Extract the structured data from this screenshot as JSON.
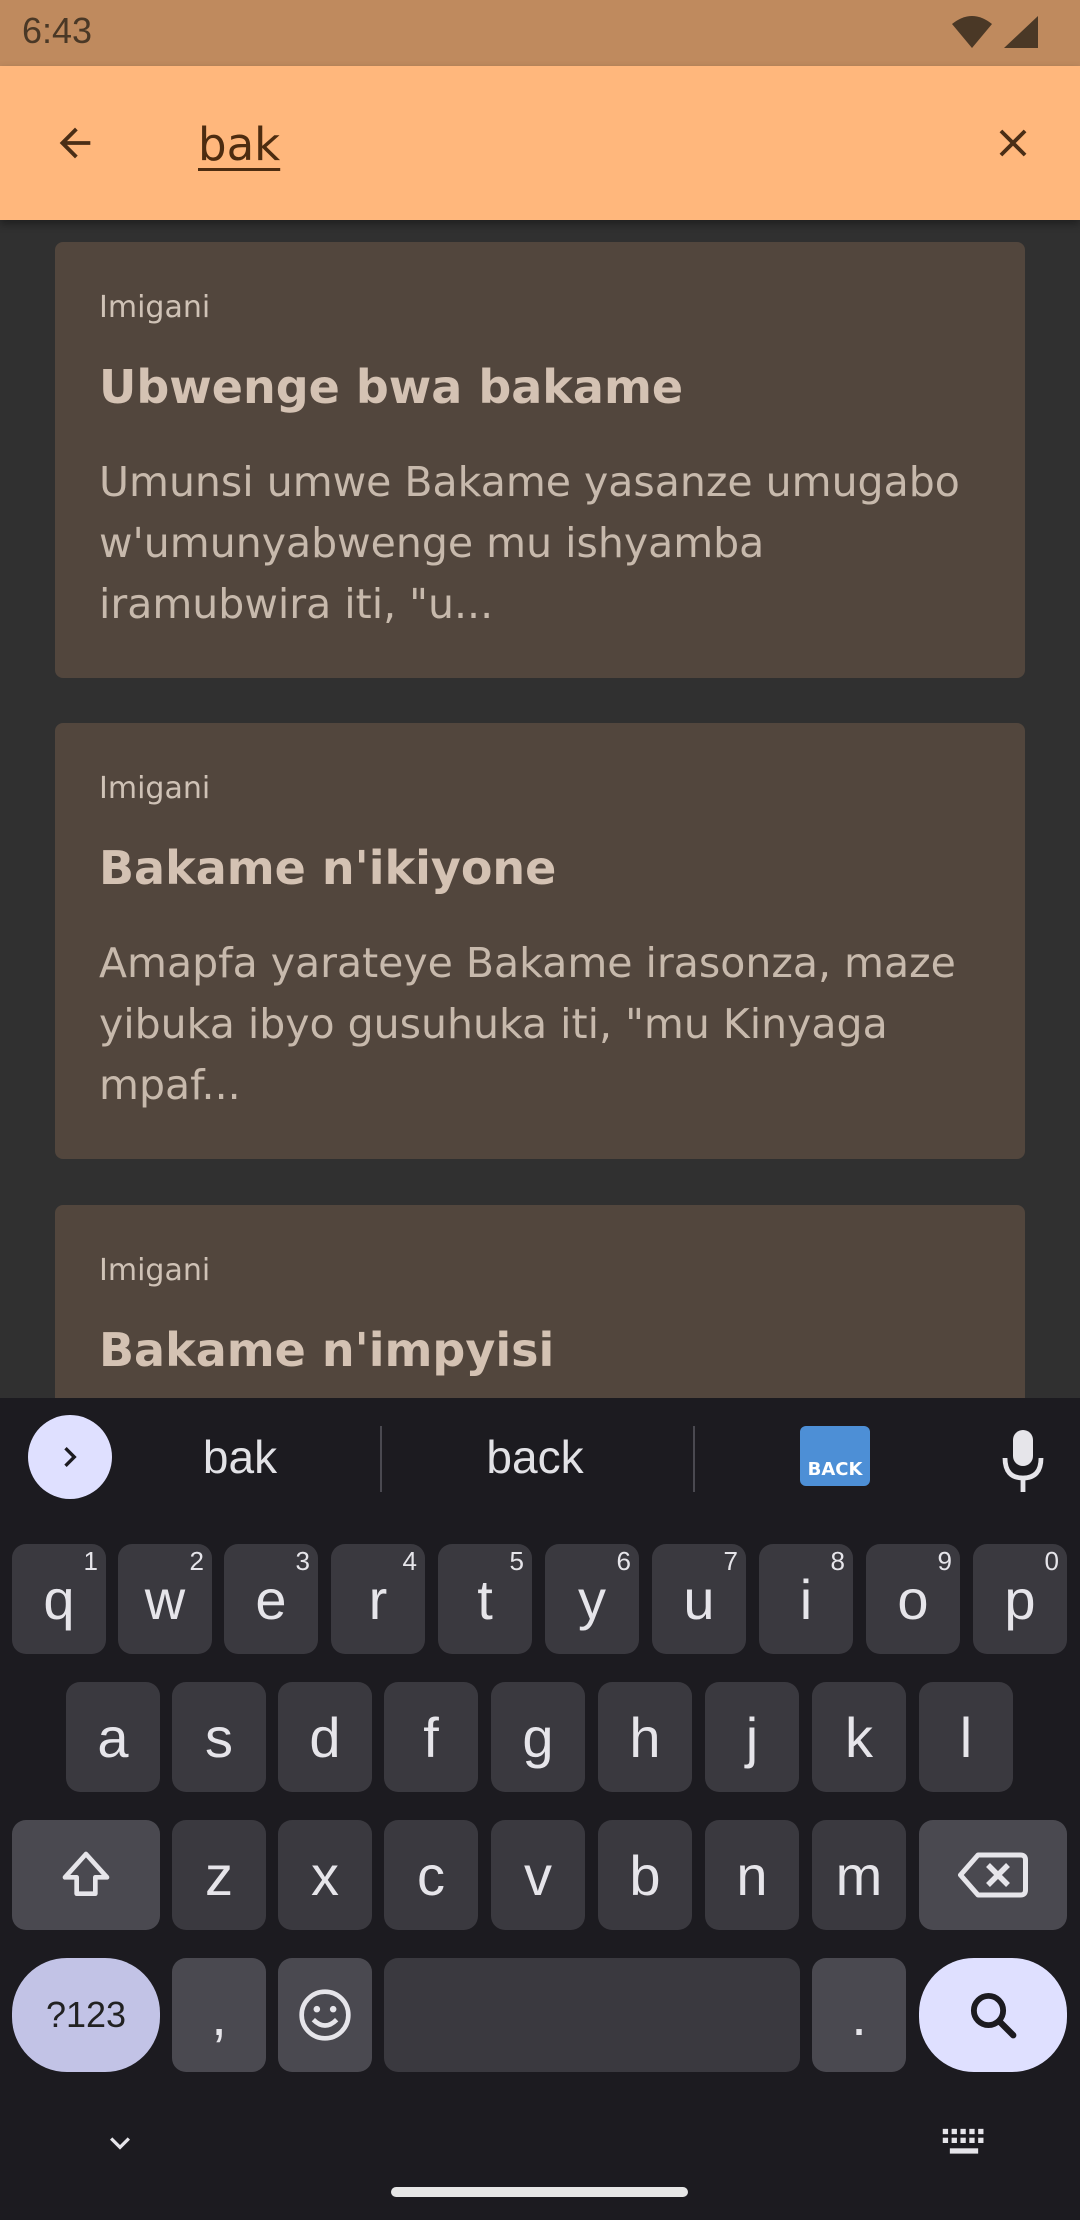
{
  "status": {
    "time": "6:43"
  },
  "search": {
    "query": "bak",
    "placeholder": ""
  },
  "results": [
    {
      "category": "Imigani",
      "title": "Ubwenge bwa bakame",
      "excerpt": "Umunsi umwe Bakame yasanze umugabo w'umunyabwenge mu ishyamba iramubwira iti, \"u..."
    },
    {
      "category": "Imigani",
      "title": "Bakame n'ikiyone",
      "excerpt": "Amapfa yarateye Bakame irasonza, maze yibuka ibyo gusuhuka iti, \"mu Kinyaga mpaf..."
    },
    {
      "category": "Imigani",
      "title": "Bakame n'impyisi",
      "excerpt": ""
    }
  ],
  "keyboard": {
    "suggestions": [
      "bak",
      "back"
    ],
    "emoji_label": "BACK",
    "row1": [
      {
        "k": "q",
        "h": "1"
      },
      {
        "k": "w",
        "h": "2"
      },
      {
        "k": "e",
        "h": "3"
      },
      {
        "k": "r",
        "h": "4"
      },
      {
        "k": "t",
        "h": "5"
      },
      {
        "k": "y",
        "h": "6"
      },
      {
        "k": "u",
        "h": "7"
      },
      {
        "k": "i",
        "h": "8"
      },
      {
        "k": "o",
        "h": "9"
      },
      {
        "k": "p",
        "h": "0"
      }
    ],
    "row2": [
      "a",
      "s",
      "d",
      "f",
      "g",
      "h",
      "j",
      "k",
      "l"
    ],
    "row3": [
      "z",
      "x",
      "c",
      "v",
      "b",
      "n",
      "m"
    ],
    "sym_label": "?123",
    "comma": ",",
    "period": "."
  },
  "colors": {
    "status_bar": "#bf8a5e",
    "app_bar": "#ffb77c",
    "card": "#52463d",
    "background": "#303030",
    "keyboard": "#1c1b20"
  }
}
